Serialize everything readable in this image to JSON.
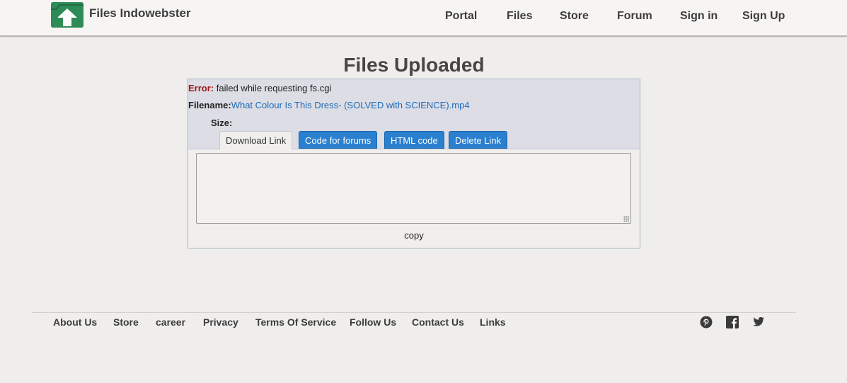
{
  "header": {
    "site_name": "Files Indowebster",
    "nav": [
      {
        "label": "Portal"
      },
      {
        "label": "Files"
      },
      {
        "label": "Store"
      },
      {
        "label": "Forum"
      },
      {
        "label": "Sign in"
      },
      {
        "label": "Sign Up"
      }
    ]
  },
  "main": {
    "title": "Files Uploaded",
    "error_label": "Error:",
    "error_text": " failed while requesting fs.cgi",
    "filename_label": "Filename:",
    "filename_value": "What Colour Is This Dress- (SOLVED with SCIENCE).mp4",
    "size_label": "Size:",
    "tabs": [
      {
        "label": "Download Link",
        "active": true
      },
      {
        "label": "Code for forums"
      },
      {
        "label": "HTML code"
      },
      {
        "label": "Delete Link"
      }
    ],
    "textarea_value": "",
    "copy_label": "copy"
  },
  "footer": {
    "links": [
      {
        "label": "About Us"
      },
      {
        "label": "Store"
      },
      {
        "label": "career"
      },
      {
        "label": "Privacy"
      },
      {
        "label": "Terms Of Service"
      },
      {
        "label": "Follow Us"
      },
      {
        "label": "Contact Us"
      },
      {
        "label": "Links"
      }
    ],
    "social_icons": [
      "pinterest-icon",
      "facebook-icon",
      "twitter-icon"
    ]
  },
  "colors": {
    "background": "#efeeec",
    "logo_green": "#2e8b57",
    "tab_blue": "#2a7fcf",
    "error_red": "#a01818",
    "link_blue": "#1e6bb8"
  }
}
